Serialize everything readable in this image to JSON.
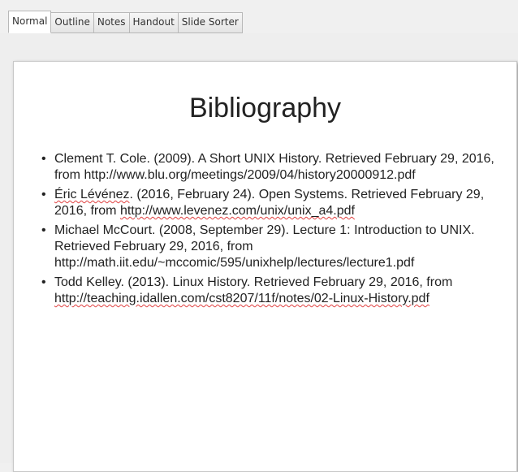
{
  "tabs": [
    "Normal",
    "Outline",
    "Notes",
    "Handout",
    "Slide Sorter"
  ],
  "active_tab": "Normal",
  "slide": {
    "title": "Bibliography",
    "bullet_glyph": "•",
    "bullets": [
      {
        "text": "Clement T. Cole. (2009). A Short UNIX History. Retrieved February 29, 2016, from",
        "link": "http://www.blu.org/meetings/2009/04/history20000912.pdf"
      },
      {
        "text_a": "Éric Lévénez",
        "text_b": ". (2016, February 24). Open Systems. Retrieved February 29, 2016, from ",
        "link": "http://www.levenez.com/unix/unix_a4.pdf"
      },
      {
        "text": "Michael McCourt. (2008, September 29). Lecture 1: Introduction to UNIX. Retrieved February 29, 2016, from",
        "link": "http://math.iit.edu/~mccomic/595/unixhelp/lectures/lecture1.pdf"
      },
      {
        "text": "Todd Kelley. (2013). Linux History. Retrieved February 29, 2016, from ",
        "link": "http://teaching.idallen.com/cst8207/11f/notes/02-Linux-History.pdf"
      }
    ]
  }
}
